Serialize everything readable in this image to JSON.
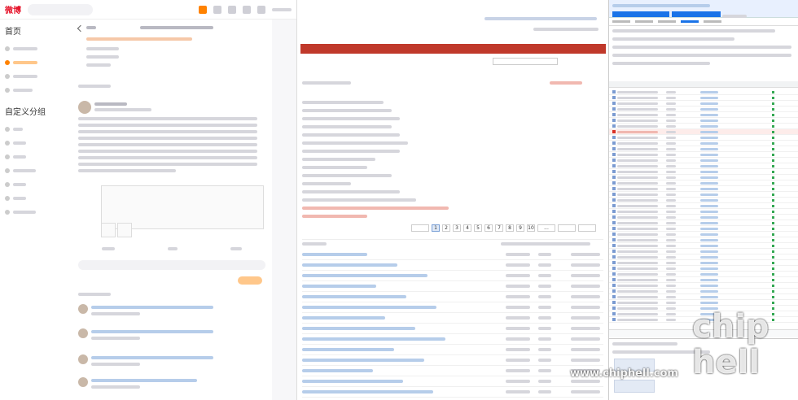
{
  "weibo": {
    "logo": "微博",
    "side_section": "首页",
    "side_group": "自定义分组",
    "tabs_count": 4
  },
  "forum": {
    "page_numbers": [
      "1",
      "2",
      "3",
      "4",
      "5",
      "6",
      "7",
      "8",
      "9",
      "10",
      "...",
      "500"
    ],
    "current_page": "1"
  },
  "devtools": {
    "tab_count": 8
  },
  "watermark": {
    "text": "chip hell",
    "url": "www.chiphell.com"
  },
  "colors": {
    "weibo_accent": "#ff8200",
    "forum_nav": "#c0392b",
    "devtools_blue": "#1a73e8",
    "error_red": "#d93025"
  }
}
